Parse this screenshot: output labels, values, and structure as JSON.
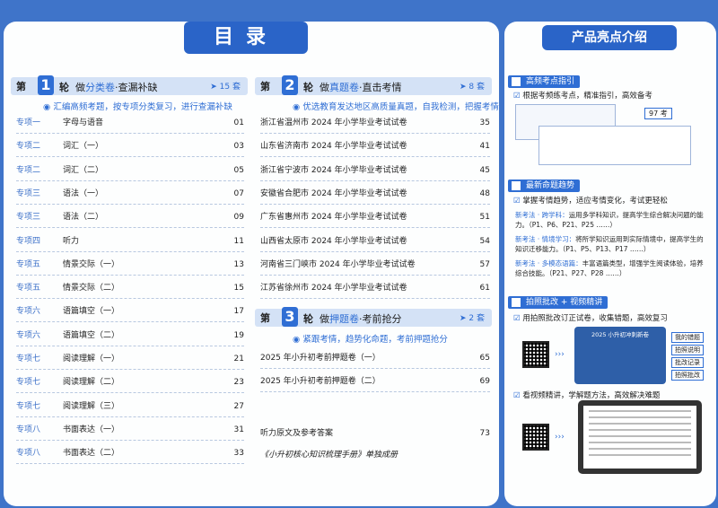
{
  "toc": {
    "title": "目录",
    "section1": {
      "tag": "第",
      "num": "1",
      "lun": "轮",
      "title_pre": "做",
      "title_hl": "分类卷",
      "title_post": "·查漏补缺",
      "count": "➤ 15 套",
      "note": "汇编高频考题，按专项分类复习，进行查漏补缺",
      "rows": [
        {
          "code": "专项一",
          "name": "字母与语音",
          "page": "01"
        },
        {
          "code": "专项二",
          "name": "词汇（一）",
          "page": "03"
        },
        {
          "code": "专项二",
          "name": "词汇（二）",
          "page": "05"
        },
        {
          "code": "专项三",
          "name": "语法（一）",
          "page": "07"
        },
        {
          "code": "专项三",
          "name": "语法（二）",
          "page": "09"
        },
        {
          "code": "专项四",
          "name": "听力",
          "page": "11"
        },
        {
          "code": "专项五",
          "name": "情景交际（一）",
          "page": "13"
        },
        {
          "code": "专项五",
          "name": "情景交际（二）",
          "page": "15"
        },
        {
          "code": "专项六",
          "name": "语篇填空（一）",
          "page": "17"
        },
        {
          "code": "专项六",
          "name": "语篇填空（二）",
          "page": "19"
        },
        {
          "code": "专项七",
          "name": "阅读理解（一）",
          "page": "21"
        },
        {
          "code": "专项七",
          "name": "阅读理解（二）",
          "page": "23"
        },
        {
          "code": "专项七",
          "name": "阅读理解（三）",
          "page": "27"
        },
        {
          "code": "专项八",
          "name": "书面表达（一）",
          "page": "31"
        },
        {
          "code": "专项八",
          "name": "书面表达（二）",
          "page": "33"
        }
      ]
    },
    "section2": {
      "tag": "第",
      "num": "2",
      "lun": "轮",
      "title_pre": "做",
      "title_hl": "真题卷",
      "title_post": "·直击考情",
      "count": "➤ 8 套",
      "note": "优选教育发达地区高质量真题，自我检测，把握考情",
      "rows": [
        {
          "name": "浙江省温州市 2024 年小学毕业考试试卷",
          "page": "35"
        },
        {
          "name": "山东省济南市 2024 年小学毕业考试试卷",
          "page": "41"
        },
        {
          "name": "浙江省宁波市 2024 年小学毕业考试试卷",
          "page": "45"
        },
        {
          "name": "安徽省合肥市 2024 年小学毕业考试试卷",
          "page": "48"
        },
        {
          "name": "广东省惠州市 2024 年小学毕业考试试卷",
          "page": "51"
        },
        {
          "name": "山西省太原市 2024 年小学毕业考试试卷",
          "page": "54"
        },
        {
          "name": "河南省三门峡市 2024 年小学毕业考试试卷",
          "page": "57"
        },
        {
          "name": "江苏省徐州市 2024 年小学毕业考试试卷",
          "page": "61"
        }
      ]
    },
    "section3": {
      "tag": "第",
      "num": "3",
      "lun": "轮",
      "title_pre": "做",
      "title_hl": "押题卷",
      "title_post": "·考前抢分",
      "count": "➤ 2 套",
      "note": "紧跟考情，趋势化命题，考前押题抢分",
      "rows": [
        {
          "name": "2025 年小升初考前押题卷（一）",
          "page": "65"
        },
        {
          "name": "2025 年小升初考前押题卷（二）",
          "page": "69"
        }
      ]
    },
    "extra": {
      "name": "听力原文及参考答案",
      "page": "73"
    },
    "footer": "《小升初核心知识梳理手册》单独成册"
  },
  "features": {
    "title": "产品亮点介绍",
    "f1": {
      "label": "高频考点指引",
      "check": "根据考频练考点，精准指引，高效备考",
      "badge": "97 考"
    },
    "f2": {
      "label": "最新命题趋势",
      "check": "掌握考情趋势，适应考情变化，考试更轻松",
      "items": [
        {
          "key": "新考法 · 跨学科：",
          "text": "运用多学科知识，提高学生综合解决问题的能力。（P1、P6、P21、P25 ……）"
        },
        {
          "key": "新考法 · 情境学习：",
          "text": "将所学知识运用到实际情境中，提高学生的知识迁移能力。（P1、P5、P13、P17 ……）"
        },
        {
          "key": "新考法 · 多模态语篇：",
          "text": "丰富语篇类型，增强学生阅读体验，培养综合技能。（P21、P27、P28 ……）"
        }
      ]
    },
    "f3": {
      "label": "拍照批改 + 视频精讲",
      "check1": "用拍照批改订正试卷，收集错题，高效复习",
      "phone_title": "2025 小升初冲刺新卷",
      "phone_labels": [
        "我的错题",
        "拍照说明",
        "批改记录",
        "拍照批改"
      ],
      "check2": "看视频精讲，学解题方法，高效解决难题"
    }
  }
}
